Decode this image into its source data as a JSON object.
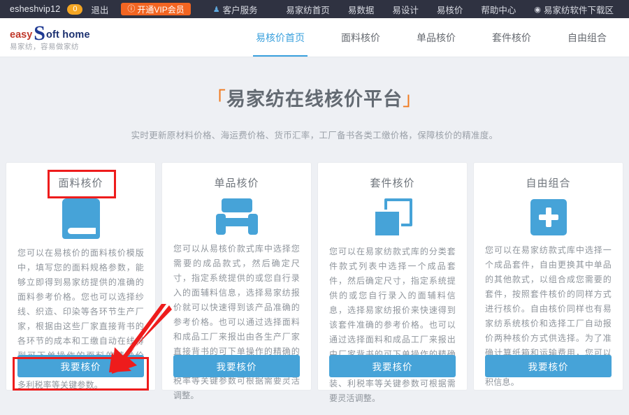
{
  "topbar": {
    "username": "esheshvip12",
    "badge_count": "0",
    "logout_label": "退出",
    "vip_label": "开通VIP会员",
    "vip_icon": "clock-icon",
    "vip_color": "#f26522",
    "service_label": "客户服务",
    "service_icon": "user-icon",
    "nav": [
      {
        "label": "易家纺首页",
        "icon": ""
      },
      {
        "label": "易数据",
        "icon": ""
      },
      {
        "label": "易设计",
        "icon": ""
      },
      {
        "label": "易核价",
        "icon": ""
      },
      {
        "label": "帮助中心",
        "icon": ""
      },
      {
        "label": "易家纺软件下载区",
        "icon": "download-icon"
      }
    ]
  },
  "logo": {
    "easy": "easy",
    "s": "S",
    "soft": "oft home",
    "slogan": "易家纺，容易做家纺"
  },
  "mainnav": {
    "active_index": 0,
    "items": [
      {
        "label": "易核价首页"
      },
      {
        "label": "面料核价"
      },
      {
        "label": "单品核价"
      },
      {
        "label": "套件核价"
      },
      {
        "label": "自由组合"
      }
    ],
    "accent": "#3aa0dd"
  },
  "hero": {
    "bracket_open": "「",
    "bracket_close": "」",
    "title": "易家纺在线核价平台",
    "subtitle": "实时更新原材料价格、海运费价格、货币汇率，工厂备书各类工缴价格，保障核价的精准度。",
    "bracket_color": "#f07a1f"
  },
  "cards": [
    {
      "title": "面料核价",
      "icon": "book-icon",
      "text": "您可以在易核价的面料核价模版中，填写您的面料规格参数，能够立即得到易家纺提供的准确的面料参考价格。您也可以选择纱线、织造、印染等各环节生产厂家，根据由这些厂家直接背书的各环节的成本和工缴自动在线得到可下单操作的面料的精确价格。还可以根据需要灵活调整更多利税率等关键参数。",
      "button": "我要核价"
    },
    {
      "title": "单品核价",
      "icon": "armchair-icon",
      "text": "您可以从易核价款式库中选择您需要的成品款式，然后确定尺寸，指定系统提供的或您自行录入的面辅料信息，选择易家纺报价就可以快速得到该产品准确的参考价格。也可以通过选择面料和成品工厂来报出由各生产厂家直接背书的可下单操作的精确的成品价格。还有辅料、包装、利税率等关键参数可根据需要灵活调整。",
      "button": "我要核价"
    },
    {
      "title": "套件核价",
      "icon": "layers-icon",
      "text": "您可以在易家纺款式库的分类套件款式列表中选择一个成品套件，然后确定尺寸，指定系统提供的或您自行录入的面辅料信息，选择易家纺报价来快速得到该套件准确的参考价格。也可以通过选择面料和成品工厂来报出由厂家背书的可下单操作的精确的成品套件价格。还有辅料、包装、利税率等关键参数可根据需要灵活调整。",
      "button": "我要核价"
    },
    {
      "title": "自由组合",
      "icon": "plus-icon",
      "text": "您可以在易家纺款式库中选择一个成品套件，自由更换其中单品的其他款式，以组合成您需要的套件，按照套件核价的同样方式进行核价。自由核价同样也有易家纺系统核价和选择工厂自动报价两种核价方式供选择。为了准确计算纸箱和运输费用，您可以重新选择系统体积经验库中的体积信息。",
      "button": "我要核价"
    }
  ],
  "annotations": {
    "highlight_color": "#ee1c1c",
    "title_box_target": "面料核价",
    "button_box_target": "我要核价",
    "arrow": "red-arrow-pointing-to-button"
  }
}
